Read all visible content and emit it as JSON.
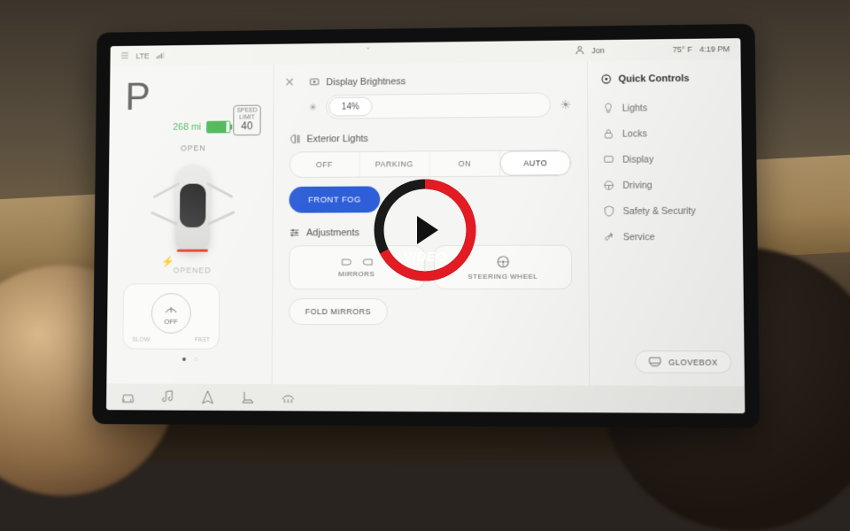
{
  "statusbar": {
    "lte": "LTE",
    "user": "Jon",
    "temp": "75° F",
    "time": "4:19 PM"
  },
  "left": {
    "gear": "P",
    "range": "268 mi",
    "speed_limit_label": "SPEED\nLIMIT",
    "speed_limit_value": "40",
    "open_label": "OPEN",
    "opened_label": "OPENED",
    "wiper_off": "OFF",
    "wiper_slow": "SLOW",
    "wiper_fast": "FAST"
  },
  "mid": {
    "brightness_title": "Display Brightness",
    "brightness_value": "14%",
    "exterior_title": "Exterior Lights",
    "ext_opts": {
      "off": "OFF",
      "parking": "PARKING",
      "on": "ON",
      "auto": "AUTO"
    },
    "front_fog": "FRONT FOG",
    "adjust_title": "Adjustments",
    "mirrors": "MIRRORS",
    "steering": "STEERING WHEEL",
    "fold": "FOLD MIRRORS"
  },
  "right": {
    "header": "Quick Controls",
    "items": [
      {
        "label": "Lights"
      },
      {
        "label": "Locks"
      },
      {
        "label": "Display"
      },
      {
        "label": "Driving"
      },
      {
        "label": "Safety & Security"
      },
      {
        "label": "Service"
      }
    ],
    "glovebox": "GLOVEBOX"
  },
  "overlay": {
    "label": "VIDEO"
  }
}
